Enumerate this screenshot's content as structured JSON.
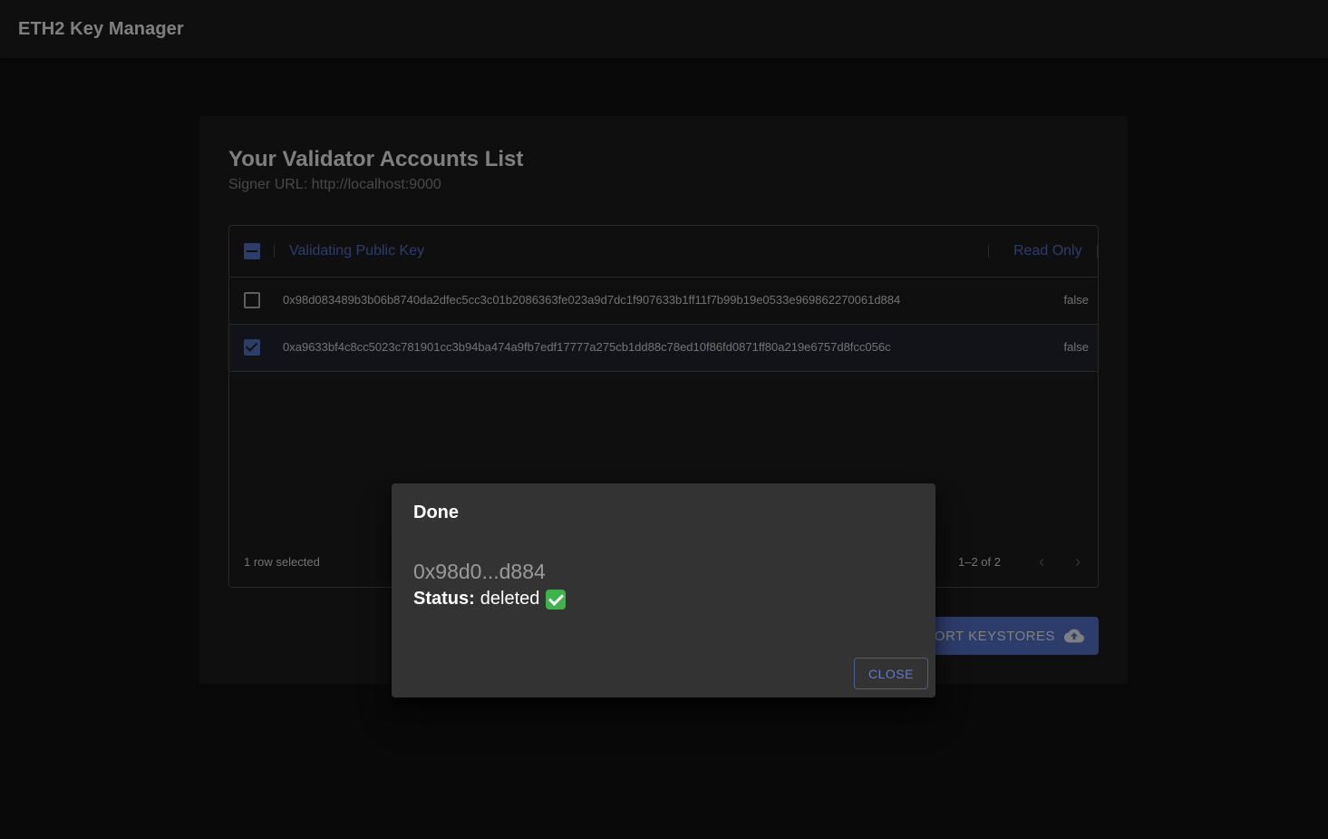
{
  "app": {
    "title": "ETH2 Key Manager"
  },
  "card": {
    "title": "Your Validator Accounts List",
    "subtitle": "Signer URL: http://localhost:9000"
  },
  "grid": {
    "columns": {
      "key": "Validating Public Key",
      "read_only": "Read Only"
    },
    "header_checkbox": "indeterminate",
    "rows": [
      {
        "key": "0x98d083489b3b06b8740da2dfec5cc3c01b2086363fe023a9d7dc1f907633b1ff11f7b99b19e0533e969862270061d884",
        "read_only": "false",
        "checked": false
      },
      {
        "key": "0xa9633bf4c8cc5023c781901cc3b94ba474a9fb7edf17777a275cb1dd88c78ed10f86fd0871ff80a219e6757d8fcc056c",
        "read_only": "false",
        "checked": true
      }
    ],
    "footer": {
      "selected_text": "1 row selected",
      "pagination": "1–2 of 2"
    }
  },
  "import_button": {
    "label": "ORT KEYSTORES",
    "icon": "cloud-upload-icon"
  },
  "dialog": {
    "title": "Done",
    "key_short": "0x98d0...d884",
    "status_label": "Status:",
    "status_value": "deleted",
    "status_icon": "check-mark-icon",
    "close_label": "CLOSE"
  },
  "colors": {
    "accent": "#5b7bd6",
    "background": "#121212",
    "surface": "#1e1e1e",
    "dialog": "#333333",
    "success": "#3bb54a"
  }
}
